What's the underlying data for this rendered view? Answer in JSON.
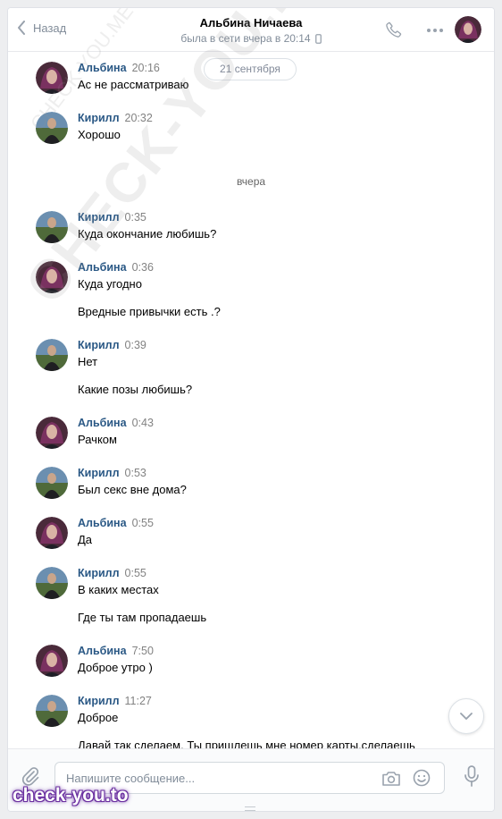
{
  "header": {
    "back_label": "Назад",
    "peer_name": "Альбина Ничаева",
    "peer_status": "была в сети вчера в 20:14"
  },
  "chat": {
    "date_pill": "21 сентября",
    "separator": "вчера",
    "messages": [
      {
        "author": "Альбина",
        "time": "20:16",
        "lines": [
          "Ас не рассматриваю"
        ]
      },
      {
        "author": "Кирилл",
        "time": "20:32",
        "lines": [
          "Хорошо"
        ]
      },
      {
        "author": "Кирилл",
        "time": "0:35",
        "lines": [
          "Куда окончание любишь?"
        ]
      },
      {
        "author": "Альбина",
        "time": "0:36",
        "lines": [
          "Куда угодно",
          "Вредные привычки есть .?"
        ]
      },
      {
        "author": "Кирилл",
        "time": "0:39",
        "lines": [
          "Нет",
          "Какие позы любишь?"
        ]
      },
      {
        "author": "Альбина",
        "time": "0:43",
        "lines": [
          "Рачком"
        ]
      },
      {
        "author": "Кирилл",
        "time": "0:53",
        "lines": [
          "Был секс вне дома?"
        ]
      },
      {
        "author": "Альбина",
        "time": "0:55",
        "lines": [
          "Да"
        ]
      },
      {
        "author": "Кирилл",
        "time": "0:55",
        "lines": [
          "В каких местах",
          "Где ты там пропадаешь"
        ]
      },
      {
        "author": "Альбина",
        "time": "7:50",
        "lines": [
          "Доброе утро )"
        ]
      },
      {
        "author": "Кирилл",
        "time": "11:27",
        "lines": [
          "Доброе",
          "Давай так сделаем. Ты пришлешь мне номер карты,сделаешь"
        ]
      }
    ]
  },
  "composer": {
    "placeholder": "Напишите сообщение..."
  },
  "watermarks": {
    "diagonal": "CHECK-YOU.ME",
    "small": "CHECK-YOU.ME",
    "logo": "check-you.to"
  },
  "colors": {
    "author": "#2a5885",
    "time": "#828282",
    "muted": "#818c99",
    "logo_glow": "#6a2fa0"
  }
}
